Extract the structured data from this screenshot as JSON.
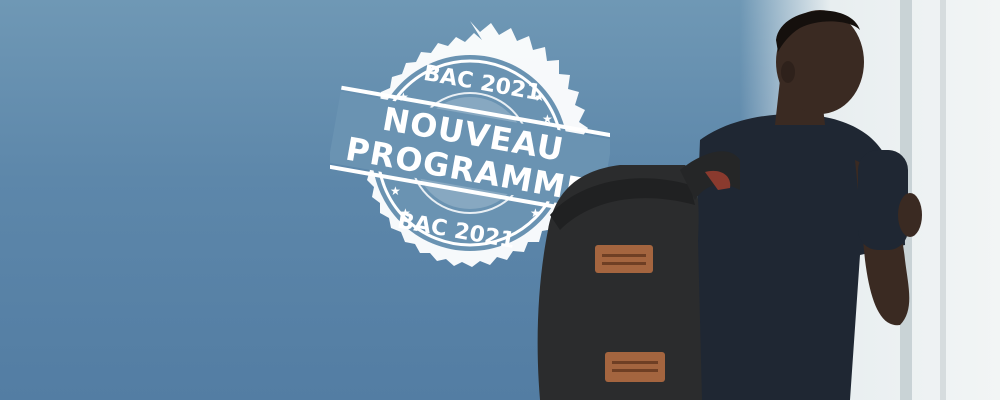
{
  "stamp": {
    "top_text": "BAC 2021",
    "line1": "NOUVEAU",
    "line2": "PROGRAMME",
    "bottom_text": "BAC 2021"
  },
  "colors": {
    "background": "#5d87aa",
    "stamp": "#ffffff",
    "shirt": "#1f2733",
    "backpack": "#2b2c2d",
    "strap_leather": "#a4653f"
  }
}
